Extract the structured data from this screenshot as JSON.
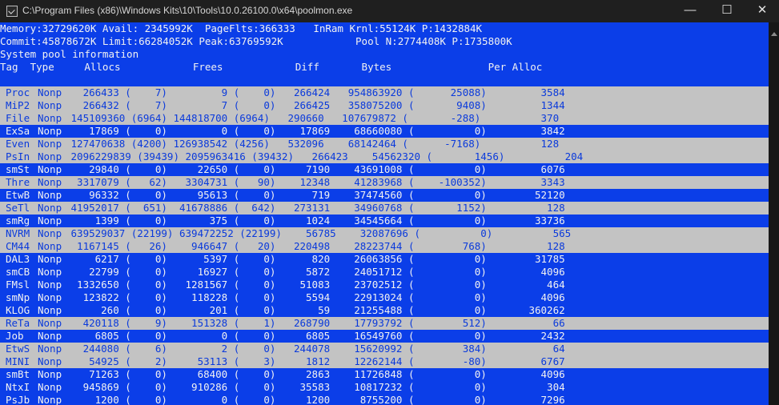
{
  "window": {
    "title": "C:\\Program Files (x86)\\Windows Kits\\10\\Tools\\10.0.26100.0\\x64\\poolmon.exe",
    "icon": "terminal-icon",
    "minimize_glyph": "—",
    "maximize_glyph": "☐",
    "close_glyph": "✕"
  },
  "header": {
    "line1": "Memory:32729620K Avail: 2345992K  PageFlts:366333   InRam Krnl:55124K P:1432884K",
    "line2": "Commit:45878672K Limit:66284052K Peak:63769592K            Pool N:2774408K P:1735800K",
    "line3": "System pool information",
    "line4": "Tag  Type     Allocs            Frees            Diff       Bytes                Per Alloc"
  },
  "rows": [
    {
      "tag": "Proc",
      "type": "Nonp",
      "nums": "   266433 (    7)         9 (    0)   266424   954863920 (      25088)         3584",
      "style": "gray"
    },
    {
      "tag": "MiP2",
      "type": "Nonp",
      "nums": "   266432 (    7)         7 (    0)   266425   358075200 (       9408)         1344",
      "style": "gray"
    },
    {
      "tag": "File",
      "type": "Nonp",
      "nums": " 145109360 (6964) 144818700 (6964)   290660   107679872 (       -288)          370",
      "style": "gray"
    },
    {
      "tag": "ExSa",
      "type": "Nonp",
      "nums": "    17869 (    0)         0 (    0)    17869    68660080 (          0)         3842",
      "style": "blue"
    },
    {
      "tag": "Even",
      "type": "Nonp",
      "nums": " 127470638 (4200) 126938542 (4256)   532096    68142464 (      -7168)          128",
      "style": "gray"
    },
    {
      "tag": "PsIn",
      "type": "Nonp",
      "nums": " 2096229839 (39439) 2095963416 (39432)   266423    54562320 (       1456)          204",
      "style": "gray"
    },
    {
      "tag": "smSt",
      "type": "Nonp",
      "nums": "    29840 (    0)     22650 (    0)     7190    43691008 (          0)         6076",
      "style": "blue"
    },
    {
      "tag": "Thre",
      "type": "Nonp",
      "nums": "  3317079 (   62)   3304731 (   90)    12348    41283968 (    -100352)         3343",
      "style": "gray"
    },
    {
      "tag": "EtwB",
      "type": "Nonp",
      "nums": "    96332 (    0)     95613 (    0)      719    37474560 (          0)        52120",
      "style": "blue"
    },
    {
      "tag": "SeTl",
      "type": "Nonp",
      "nums": " 41952017 (  651)  41678886 (  642)   273131    34960768 (       1152)          128",
      "style": "gray"
    },
    {
      "tag": "smRg",
      "type": "Nonp",
      "nums": "     1399 (    0)       375 (    0)     1024    34545664 (          0)        33736",
      "style": "blue"
    },
    {
      "tag": "NVRM",
      "type": "Nonp",
      "nums": " 639529037 (22199) 639472252 (22199)    56785    32087696 (          0)          565",
      "style": "gray"
    },
    {
      "tag": "CM44",
      "type": "Nonp",
      "nums": "  1167145 (   26)    946647 (   20)   220498    28223744 (        768)          128",
      "style": "gray"
    },
    {
      "tag": "DAL3",
      "type": "Nonp",
      "nums": "     6217 (    0)      5397 (    0)      820    26063856 (          0)        31785",
      "style": "blue"
    },
    {
      "tag": "smCB",
      "type": "Nonp",
      "nums": "    22799 (    0)     16927 (    0)     5872    24051712 (          0)         4096",
      "style": "blue"
    },
    {
      "tag": "FMsl",
      "type": "Nonp",
      "nums": "  1332650 (    0)   1281567 (    0)    51083    23702512 (          0)          464",
      "style": "blue"
    },
    {
      "tag": "smNp",
      "type": "Nonp",
      "nums": "   123822 (    0)    118228 (    0)     5594    22913024 (          0)         4096",
      "style": "blue"
    },
    {
      "tag": "KLOG",
      "type": "Nonp",
      "nums": "      260 (    0)       201 (    0)       59    21255488 (          0)       360262",
      "style": "blue"
    },
    {
      "tag": "ReTa",
      "type": "Nonp",
      "nums": "   420118 (    9)    151328 (    1)   268790    17793792 (        512)           66",
      "style": "gray"
    },
    {
      "tag": "Job ",
      "type": "Nonp",
      "nums": "     6805 (    0)         0 (    0)     6805    16549760 (          0)         2432",
      "style": "blue"
    },
    {
      "tag": "EtwS",
      "type": "Nonp",
      "nums": "   244080 (    6)         2 (    0)   244078    15620992 (        384)           64",
      "style": "gray"
    },
    {
      "tag": "MINI",
      "type": "Nonp",
      "nums": "    54925 (    2)     53113 (    3)     1812    12262144 (        -80)         6767",
      "style": "gray"
    },
    {
      "tag": "smBt",
      "type": "Nonp",
      "nums": "    71263 (    0)     68400 (    0)     2863    11726848 (          0)         4096",
      "style": "blue"
    },
    {
      "tag": "NtxI",
      "type": "Nonp",
      "nums": "   945869 (    0)    910286 (    0)    35583    10817232 (          0)          304",
      "style": "blue"
    },
    {
      "tag": "PsJb",
      "type": "Nonp",
      "nums": "     1200 (    0)         0 (    0)     1200     8755200 (          0)         7296",
      "style": "blue"
    }
  ]
}
